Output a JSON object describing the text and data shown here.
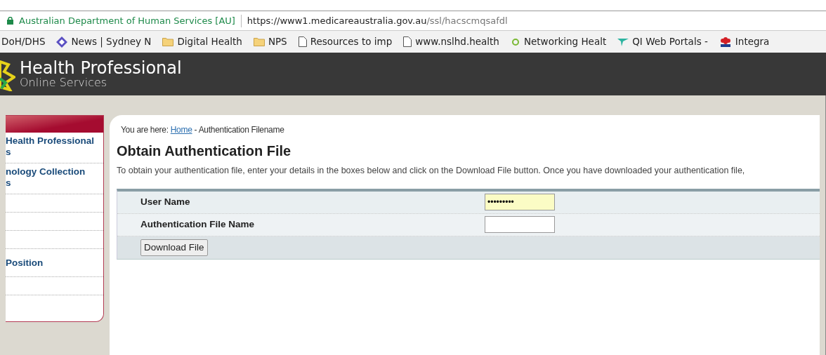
{
  "browser": {
    "site_identity": "Australian Department of Human Services [AU]",
    "url_host": "https://www1.medicareaustralia.gov.au",
    "url_path": "/ssl/hacscmqsafdl",
    "bookmarks": [
      {
        "label": "DoH/DHS",
        "kind": "none"
      },
      {
        "label": "News | Sydney N",
        "kind": "diamond"
      },
      {
        "label": "Digital Health",
        "kind": "folder"
      },
      {
        "label": "NPS",
        "kind": "folder"
      },
      {
        "label": "Resources to imp",
        "kind": "page"
      },
      {
        "label": "www.nslhd.health",
        "kind": "page"
      },
      {
        "label": "Networking Healt",
        "kind": "ring"
      },
      {
        "label": "QI Web Portals -",
        "kind": "arrow"
      },
      {
        "label": "Integra",
        "kind": "flower"
      }
    ]
  },
  "header": {
    "title": "Health Professional",
    "subtitle": "Online Services"
  },
  "sidebar": {
    "items": [
      {
        "kind": "link",
        "lines": [
          "Health Professional",
          "s"
        ]
      },
      {
        "kind": "link",
        "lines": [
          "nology Collection",
          "s"
        ]
      },
      {
        "kind": "blank"
      },
      {
        "kind": "blank"
      },
      {
        "kind": "blank"
      },
      {
        "kind": "link",
        "lines": [
          "Position"
        ]
      },
      {
        "kind": "blank"
      }
    ]
  },
  "breadcrumb": {
    "prefix": "You are here:",
    "link": "Home",
    "current": "- Authentication Filename"
  },
  "title": "Obtain Authentication File",
  "intro": "To obtain your authentication file, enter your details in the boxes below and click on the Download File button. Once you have downloaded your authentication file,",
  "form": {
    "fields": [
      {
        "label": "User Name",
        "value": "•••••••••",
        "autofilled": true
      },
      {
        "label": "Authentication File Name",
        "autofilled": false
      }
    ],
    "button": "Download File"
  }
}
